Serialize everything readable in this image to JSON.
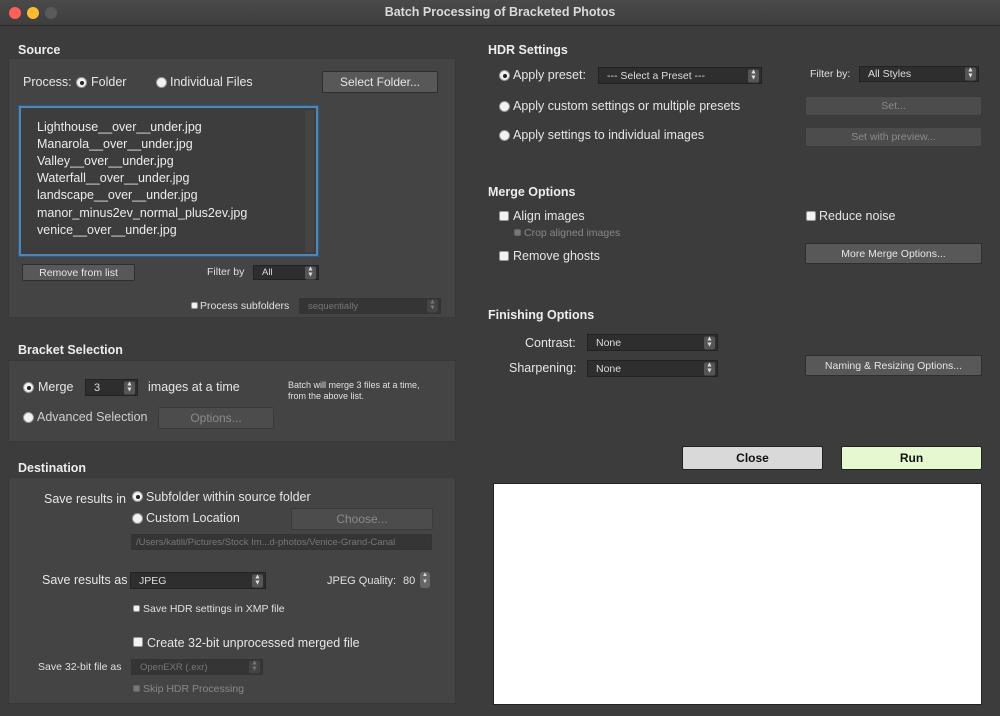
{
  "window": {
    "title": "Batch Processing of Bracketed Photos"
  },
  "source": {
    "heading": "Source",
    "process_label": "Process:",
    "folder_label": "Folder",
    "individual_label": "Individual Files",
    "select_folder_btn": "Select Folder...",
    "files": [
      "Lighthouse__over__under.jpg",
      "Manarola__over__under.jpg",
      "Valley__over__under.jpg",
      "Waterfall__over__under.jpg",
      "landscape__over__under.jpg",
      "manor_minus2ev_normal_plus2ev.jpg",
      "venice__over__under.jpg"
    ],
    "remove_btn": "Remove from list",
    "filter_label": "Filter by",
    "filter_value": "All",
    "subfolders_label": "Process subfolders",
    "subfolders_mode": "sequentially"
  },
  "bracket": {
    "heading": "Bracket Selection",
    "merge_label": "Merge",
    "merge_count": "3",
    "images_at_time": "images at a time",
    "info_line1": "Batch will merge 3 files at a time,",
    "info_line2": "from the above list.",
    "advanced_label": "Advanced Selection",
    "options_btn": "Options..."
  },
  "destination": {
    "heading": "Destination",
    "save_in_label": "Save results in",
    "subfolder_label": "Subfolder within source folder",
    "custom_label": "Custom Location",
    "choose_btn": "Choose...",
    "path": "/Users/katili/Pictures/Stock Im...d-photos/Venice-Grand-Canal",
    "save_as_label": "Save results as",
    "format_value": "JPEG",
    "quality_label": "JPEG Quality:",
    "quality_value": "80",
    "xmp_label": "Save HDR settings in XMP file",
    "create32_label": "Create 32-bit unprocessed merged file",
    "save32_label": "Save 32-bit file as",
    "save32_value": "OpenEXR (.exr)",
    "skip_label": "Skip HDR Processing"
  },
  "hdr": {
    "heading": "HDR Settings",
    "apply_preset_label": "Apply preset:",
    "preset_value": "--- Select a Preset ---",
    "filter_label": "Filter by:",
    "filter_value": "All Styles",
    "custom_label": "Apply custom settings or multiple presets",
    "set_btn": "Set...",
    "individual_label": "Apply settings to individual images",
    "set_preview_btn": "Set with preview..."
  },
  "merge": {
    "heading": "Merge Options",
    "align_label": "Align images",
    "crop_label": "Crop aligned images",
    "noise_label": "Reduce noise",
    "ghosts_label": "Remove ghosts",
    "more_btn": "More Merge Options..."
  },
  "finishing": {
    "heading": "Finishing Options",
    "contrast_label": "Contrast:",
    "contrast_value": "None",
    "sharpening_label": "Sharpening:",
    "sharpening_value": "None",
    "naming_btn": "Naming & Resizing Options..."
  },
  "actions": {
    "close_btn": "Close",
    "run_btn": "Run"
  },
  "colors": {
    "accent_blue": "#4f86b6",
    "run_green": "#e6f8cf",
    "close_gray": "#d9d9d9",
    "window_bg": "#3c3c3c"
  }
}
